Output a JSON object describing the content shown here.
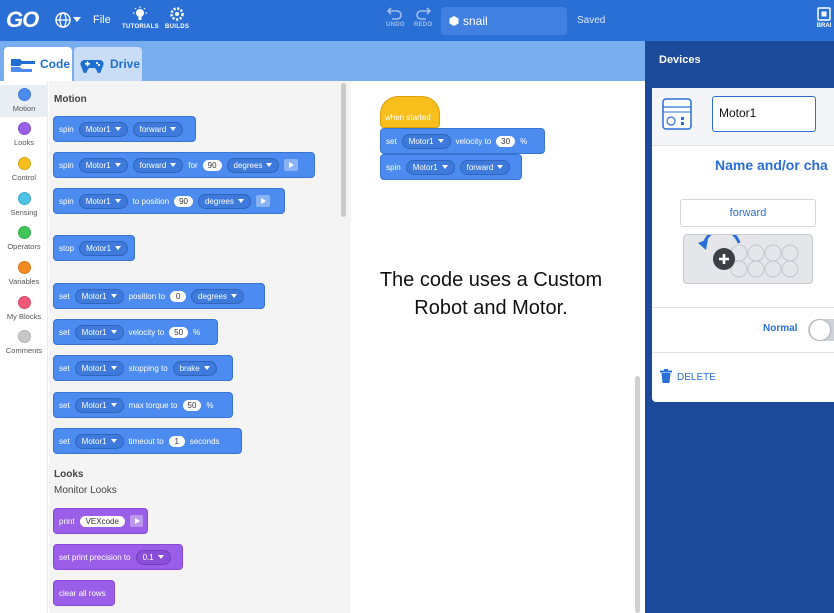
{
  "topbar": {
    "logo": "GO",
    "file_label": "File",
    "tutorials_label": "TUTORIALS",
    "builds_label": "BUILDS",
    "undo_label": "UNDO",
    "redo_label": "REDO",
    "project_name": "snail",
    "save_status": "Saved",
    "brain_label": "BRAI"
  },
  "tabs": {
    "code": "Code",
    "drive": "Drive"
  },
  "categories": [
    {
      "label": "Motion",
      "color": "#4c8bf0"
    },
    {
      "label": "Looks",
      "color": "#9a5ee8"
    },
    {
      "label": "Control",
      "color": "#f7be1c"
    },
    {
      "label": "Sensing",
      "color": "#4cc3e6"
    },
    {
      "label": "Operators",
      "color": "#3fc55a"
    },
    {
      "label": "Variables",
      "color": "#f58b1f"
    },
    {
      "label": "My Blocks",
      "color": "#f2577a"
    },
    {
      "label": "Comments",
      "color": "#c8c8c8"
    }
  ],
  "palette": {
    "motion_heading": "Motion",
    "looks_heading": "Looks",
    "monitor_looks": "Monitor Looks",
    "spin": {
      "t1": "spin",
      "motor": "Motor1",
      "dir": "forward"
    },
    "spin_for": {
      "t1": "spin",
      "motor": "Motor1",
      "dir": "forward",
      "t2": "for",
      "amount": "90",
      "unit": "degrees"
    },
    "spin_to": {
      "t1": "spin",
      "motor": "Motor1",
      "t2": "to position",
      "amount": "90",
      "unit": "degrees"
    },
    "stop": {
      "t1": "stop",
      "motor": "Motor1"
    },
    "set_position": {
      "t1": "set",
      "motor": "Motor1",
      "t2": "position to",
      "amount": "0",
      "unit": "degrees"
    },
    "set_velocity": {
      "t1": "set",
      "motor": "Motor1",
      "t2": "velocity to",
      "amount": "50",
      "unit": "%"
    },
    "set_stopping": {
      "t1": "set",
      "motor": "Motor1",
      "t2": "stopping to",
      "mode": "brake"
    },
    "set_torque": {
      "t1": "set",
      "motor": "Motor1",
      "t2": "max torque to",
      "amount": "50",
      "unit": "%"
    },
    "set_timeout": {
      "t1": "set",
      "motor": "Motor1",
      "t2": "timeout to",
      "amount": "1",
      "unit": "seconds"
    },
    "print": {
      "t1": "print",
      "value": "VEXcode"
    },
    "precision": {
      "t1": "set print precision to",
      "value": "0.1"
    },
    "clear": {
      "t1": "clear all rows"
    }
  },
  "workspace": {
    "hat": "when started",
    "set_velocity": {
      "t1": "set",
      "motor": "Motor1",
      "t2": "velocity to",
      "amount": "30",
      "unit": "%"
    },
    "spin": {
      "t1": "spin",
      "motor": "Motor1",
      "dir": "forward"
    },
    "comment_line1": "The code uses a Custom",
    "comment_line2": "Robot and Motor."
  },
  "devices": {
    "title": "Devices",
    "motor_name": "Motor1",
    "name_hint": "Name and/or cha",
    "direction": "forward",
    "mode_label": "Normal",
    "delete_label": "DELETE"
  }
}
